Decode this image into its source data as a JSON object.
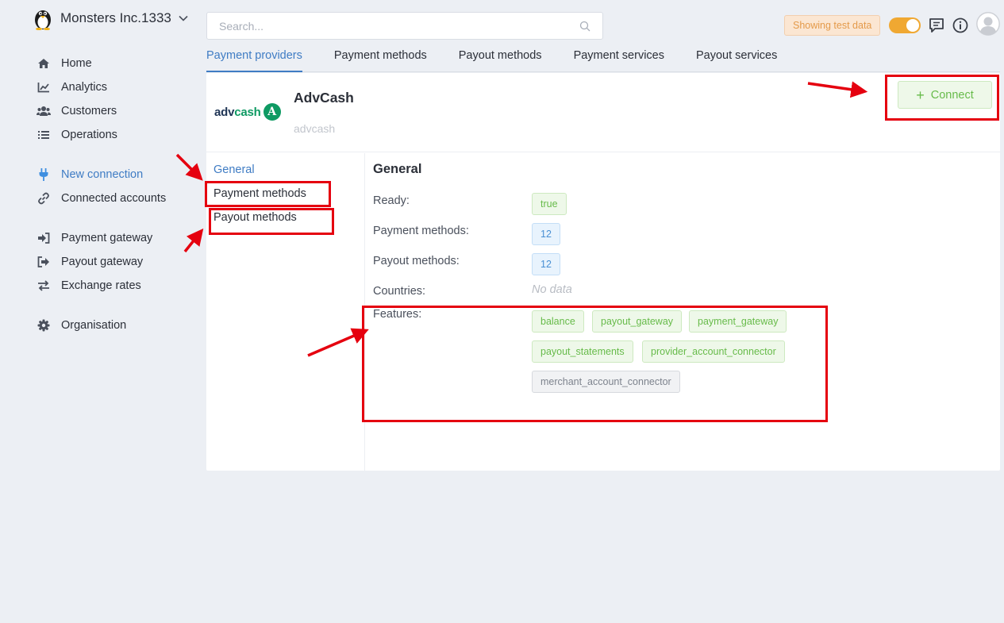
{
  "org": {
    "name": "Monsters Inc.1333",
    "icon": "penguin-icon"
  },
  "nav": {
    "home": "Home",
    "analytics": "Analytics",
    "customers": "Customers",
    "operations": "Operations",
    "new_connection": "New connection",
    "connected_accounts": "Connected accounts",
    "payment_gateway": "Payment gateway",
    "payout_gateway": "Payout gateway",
    "exchange_rates": "Exchange rates",
    "organisation": "Organisation"
  },
  "search": {
    "placeholder": "Search..."
  },
  "header": {
    "test_badge": "Showing test data"
  },
  "tabs": [
    "Payment providers",
    "Payment methods",
    "Payout methods",
    "Payment services",
    "Payout services"
  ],
  "provider": {
    "logo_text_a": "adv",
    "logo_text_b": "cash",
    "logo_badge": "A",
    "name": "AdvCash",
    "slug": "advcash",
    "connect_label": "Connect"
  },
  "side_menu": {
    "general": "General",
    "payment_methods": "Payment methods",
    "payout_methods": "Payout methods"
  },
  "general": {
    "title": "General",
    "ready_label": "Ready:",
    "ready_value": "true",
    "payment_methods_label": "Payment methods:",
    "payment_methods_value": "12",
    "payout_methods_label": "Payout methods:",
    "payout_methods_value": "12",
    "countries_label": "Countries:",
    "countries_value": "No data",
    "features_label": "Features:",
    "features": [
      "balance",
      "payout_gateway",
      "payment_gateway",
      "payout_statements",
      "provider_account_connector",
      "merchant_account_connector"
    ]
  },
  "colors": {
    "accent": "#3f7cc4",
    "success": "#67bb4a",
    "warning": "#f0a832",
    "annotation": "#e5000f"
  }
}
